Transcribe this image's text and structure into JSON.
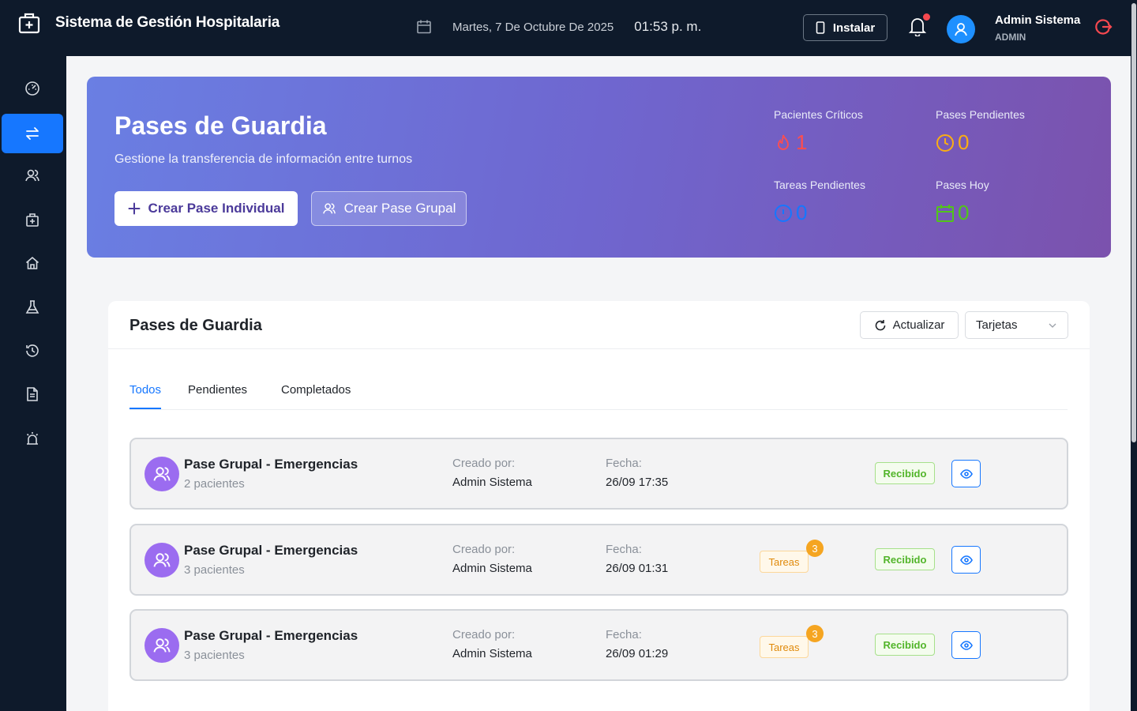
{
  "header": {
    "app_title": "Sistema de Gestión Hospitalaria",
    "date": "Martes, 7 De Octubre De 2025",
    "time": "01:53 p. m.",
    "install_label": "Instalar",
    "user_name": "Admin Sistema",
    "user_role": "ADMIN"
  },
  "sidebar": {
    "items": [
      {
        "icon": "dashboard-icon"
      },
      {
        "icon": "transfer-icon",
        "active": true
      },
      {
        "icon": "patients-icon"
      },
      {
        "icon": "hospital-icon"
      },
      {
        "icon": "home-icon"
      },
      {
        "icon": "lab-icon"
      },
      {
        "icon": "history-icon"
      },
      {
        "icon": "document-icon"
      },
      {
        "icon": "alarm-icon"
      }
    ]
  },
  "hero": {
    "title": "Pases de Guardia",
    "subtitle": "Gestione la transferencia de información entre turnos",
    "primary_button": "Crear Pase Individual",
    "secondary_button": "Crear Pase Grupal",
    "stats": [
      {
        "label": "Pacientes Críticos",
        "value": "1",
        "icon": "fire-icon",
        "color": "#ff4d4f"
      },
      {
        "label": "Pases Pendientes",
        "value": "0",
        "icon": "clock-icon",
        "color": "#faad14"
      },
      {
        "label": "Tareas Pendientes",
        "value": "0",
        "icon": "info-icon",
        "color": "#1677ff"
      },
      {
        "label": "Pases Hoy",
        "value": "0",
        "icon": "calendar-icon",
        "color": "#52c41a"
      }
    ]
  },
  "list": {
    "title": "Pases de Guardia",
    "refresh_label": "Actualizar",
    "view_mode": "Tarjetas",
    "tabs": [
      "Todos",
      "Pendientes",
      "Completados"
    ],
    "created_by_label": "Creado por:",
    "date_label": "Fecha:",
    "rows": [
      {
        "title": "Pase Grupal - Emergencias",
        "patients": "2 pacientes",
        "created_by": "Admin Sistema",
        "date": "26/09 17:35",
        "tasks_label": "",
        "tasks_count": "",
        "status": "Recibido"
      },
      {
        "title": "Pase Grupal - Emergencias",
        "patients": "3 pacientes",
        "created_by": "Admin Sistema",
        "date": "26/09 01:31",
        "tasks_label": "Tareas",
        "tasks_count": "3",
        "status": "Recibido"
      },
      {
        "title": "Pase Grupal - Emergencias",
        "patients": "3 pacientes",
        "created_by": "Admin Sistema",
        "date": "26/09 01:29",
        "tasks_label": "Tareas",
        "tasks_count": "3",
        "status": "Recibido"
      }
    ]
  },
  "colors": {
    "header_bg": "#0e1a2b",
    "accent": "#1677ff",
    "hero_start": "#6a7fe3",
    "hero_end": "#7b52ad",
    "avatar_purple": "#9b6cf0"
  }
}
